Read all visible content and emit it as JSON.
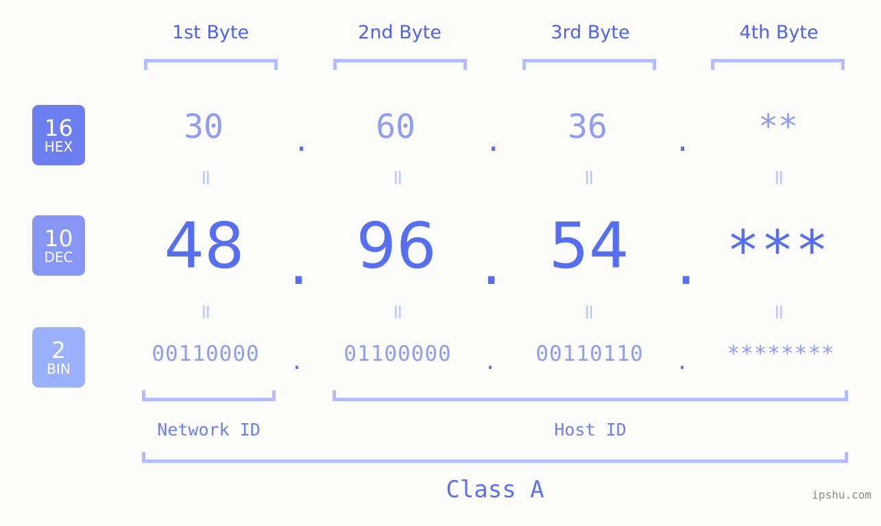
{
  "page": {
    "background_color": "#fcfdfa",
    "accent_color": "#5b6ff0",
    "bracket_color": "#b3bdfb",
    "watermark": "ipshu.com"
  },
  "byte_headers": [
    {
      "label": "1st Byte"
    },
    {
      "label": "2nd Byte"
    },
    {
      "label": "3rd Byte"
    },
    {
      "label": "4th Byte"
    }
  ],
  "bases": [
    {
      "number": "16",
      "abbr": "HEX",
      "color": "#6d7ff0"
    },
    {
      "number": "10",
      "abbr": "DEC",
      "color": "#8795f4"
    },
    {
      "number": "2",
      "abbr": "BIN",
      "color": "#9bb0fb"
    }
  ],
  "rows": {
    "hex": {
      "values": [
        "30",
        "60",
        "36",
        "**"
      ],
      "separator": "."
    },
    "dec": {
      "values": [
        "48",
        "96",
        "54",
        "***"
      ],
      "separator": "."
    },
    "bin": {
      "values": [
        "00110000",
        "01100000",
        "00110110",
        "********"
      ],
      "separator": "."
    }
  },
  "equality_marks": {
    "glyph": "=",
    "row1": [
      "=",
      "=",
      "=",
      "="
    ],
    "row2": [
      "=",
      "=",
      "=",
      "="
    ]
  },
  "sections": {
    "network_id": "Network ID",
    "host_id": "Host ID",
    "class": "Class A"
  }
}
